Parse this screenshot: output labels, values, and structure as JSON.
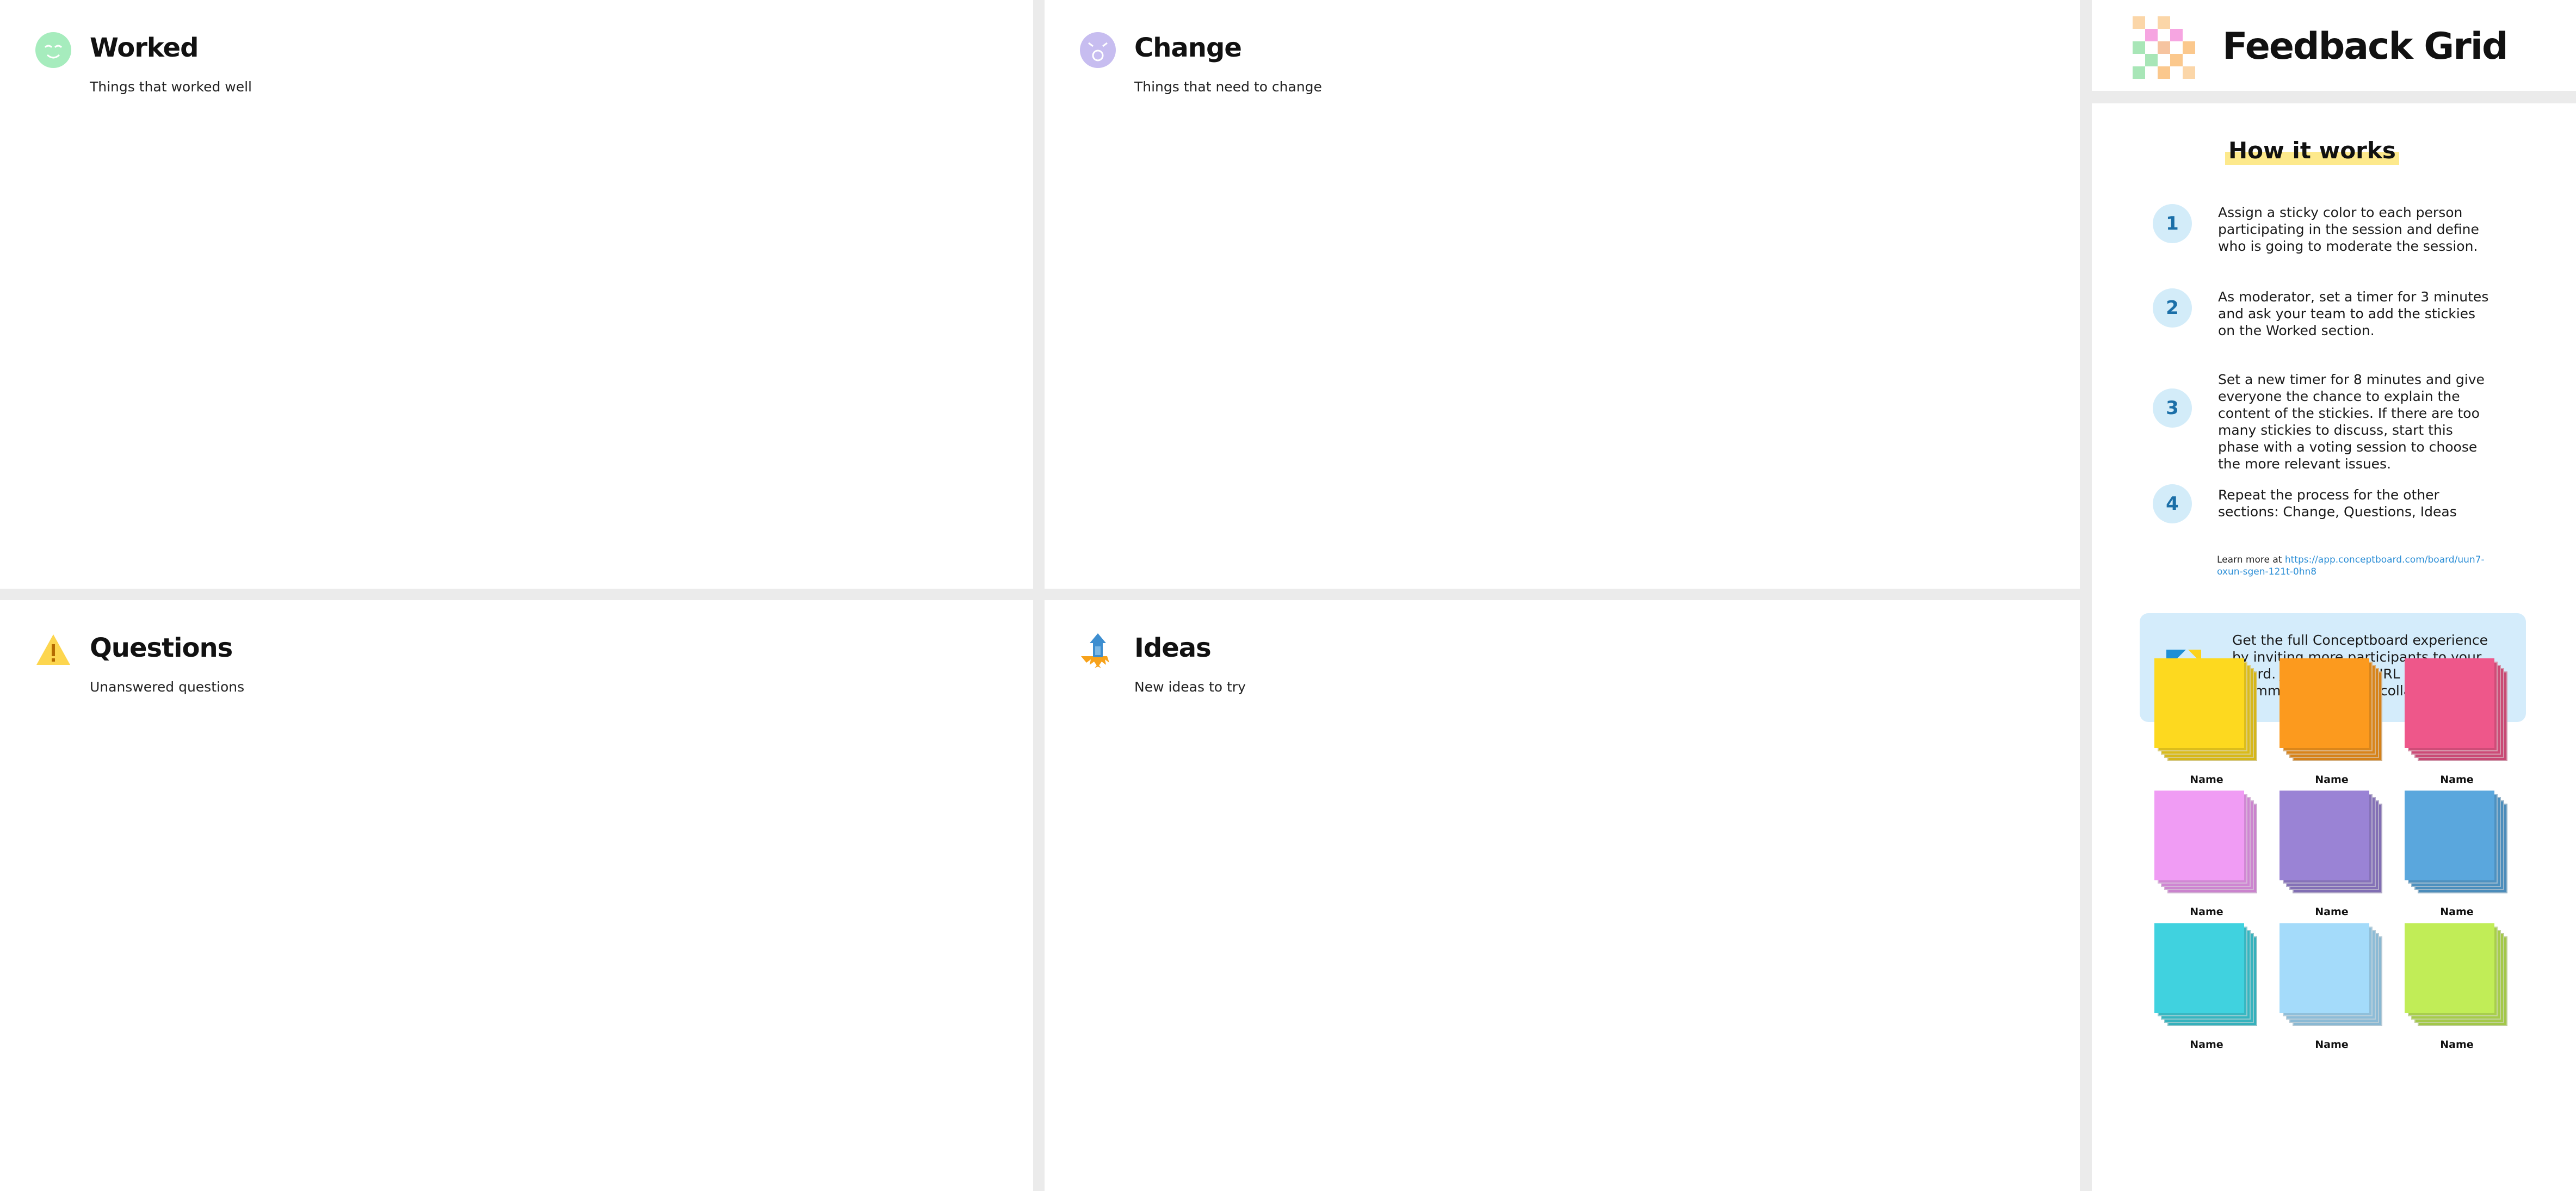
{
  "quadrants": {
    "worked": {
      "title": "Worked",
      "subtitle": "Things that worked well"
    },
    "change": {
      "title": "Change",
      "subtitle": "Things that need to change"
    },
    "questions": {
      "title": "Questions",
      "subtitle": "Unanswered questions"
    },
    "ideas": {
      "title": "Ideas",
      "subtitle": "New ideas to try"
    }
  },
  "sidebar": {
    "title": "Feedback Grid",
    "how_title": "How it works",
    "steps": [
      {
        "num": "1",
        "text": "Assign a sticky color to each person participating in the session and define who is going to moderate the session."
      },
      {
        "num": "2",
        "text": "As moderator, set a timer for 3 minutes and ask your team to add the stickies on the Worked section."
      },
      {
        "num": "3",
        "text": "Set a new timer for 8 minutes and give everyone the chance to explain the content of the stickies. If there are too many stickies to discuss, start this phase with a voting session to choose the more relevant issues."
      },
      {
        "num": "4",
        "text": "Repeat the process for the other sections: Change, Questions, Ideas"
      }
    ],
    "learn_prefix": "Learn more at ",
    "learn_link": "https://app.conceptboard.com/board/uun7-oxun-sgen-121t-0hn8",
    "promo_text": "Get the full Conceptboard experience by inviting more participants to your board. Just send the URL to your teammates and start collaborating!",
    "stickies": [
      {
        "label": "Name",
        "color": "#fdd91f"
      },
      {
        "label": "Name",
        "color": "#fc9a1e"
      },
      {
        "label": "Name",
        "color": "#ee578a"
      },
      {
        "label": "Name",
        "color": "#f09cf4"
      },
      {
        "label": "Name",
        "color": "#9a83d5"
      },
      {
        "label": "Name",
        "color": "#5aa7dd"
      },
      {
        "label": "Name",
        "color": "#40d2df"
      },
      {
        "label": "Name",
        "color": "#a4dbfa"
      },
      {
        "label": "Name",
        "color": "#c1ed57"
      }
    ]
  },
  "colors": {
    "background": "#ebebeb",
    "step_circle": "#d3ecf9",
    "step_number": "#1b6fa8",
    "promo_bg": "#d4ecfb",
    "link": "#2b8ed6",
    "highlight": "#fde98c"
  }
}
